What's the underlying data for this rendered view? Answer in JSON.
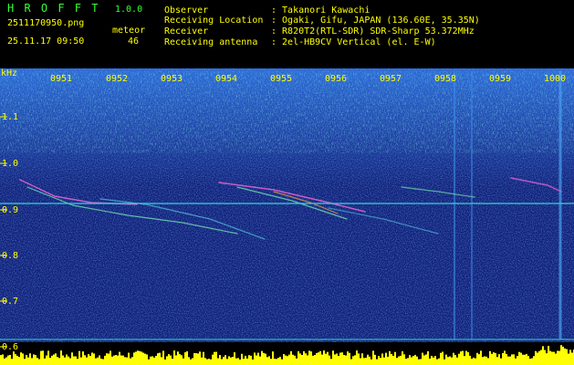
{
  "header": {
    "app_title": "H R O F F T",
    "version": "1.0.0",
    "filename": "2511170950.png",
    "datetime": "25.11.17 09:50",
    "meteor_label": "meteor",
    "meteor_count": "46"
  },
  "info": [
    {
      "label": "Observer",
      "value": ": Takanori Kawachi"
    },
    {
      "label": "Receiving Location",
      "value": ": Ogaki, Gifu, JAPAN (136.60E, 35.35N)"
    },
    {
      "label": "Receiver",
      "value": ": R820T2(RTL-SDR) SDR-Sharp 53.372MHz"
    },
    {
      "label": "Receiving antenna",
      "value": ": 2el-HB9CV Vertical (el. E-W)"
    }
  ],
  "y_axis": {
    "unit": "kHz",
    "ticks": [
      "1.1",
      "1.0",
      "0.9",
      "0.8",
      "0.7",
      "0.6"
    ]
  },
  "x_axis": {
    "ticks": [
      "0951",
      "0952",
      "0953",
      "0954",
      "0955",
      "0956",
      "0957",
      "0958",
      "0959",
      "1000"
    ]
  },
  "colors": {
    "text_yellow": "#ffff00",
    "text_white": "#ffffff",
    "reference_line": "#2fd6d6",
    "spectrum_dark": "#10207a",
    "spectrum_noise": "#2f6bd9",
    "spectrum_hot": "#34e8c6",
    "level_bar": "#ffff00"
  }
}
